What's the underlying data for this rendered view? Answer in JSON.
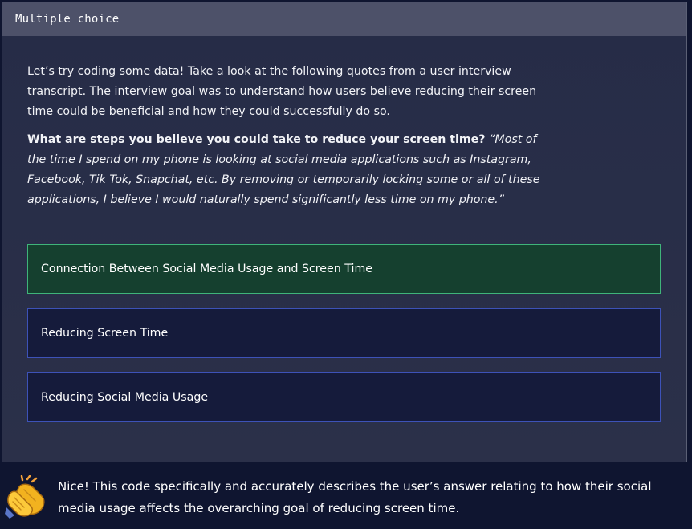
{
  "card": {
    "title": "Multiple choice"
  },
  "prompt": {
    "intro": "Let’s try coding some data! Take a look at the following quotes from a user interview transcript. The interview goal was to understand how users believe reducing their screen time could be beneficial and how they could successfully do so.",
    "question": "What are steps you believe you could take to reduce your screen time?",
    "quote": "“Most of the time I spend on my phone is looking at social media applications such as Instagram, Facebook, Tik Tok, Snapchat, etc. By removing or temporarily locking some or all of these applications, I believe I would naturally spend significantly less time on my phone.”"
  },
  "options": [
    {
      "label": "Connection Between Social Media Usage and Screen Time",
      "selected": true
    },
    {
      "label": "Reducing Screen Time",
      "selected": false
    },
    {
      "label": "Reducing Social Media Usage",
      "selected": false
    }
  ],
  "feedback": {
    "icon": "clapping-hands-icon",
    "text": "Nice! This code specifically and accurately describes the user’s answer relating to how their social media usage affects the overarching goal of reducing screen time."
  },
  "colors": {
    "page_bg": "#0f1530",
    "header_bg": "#4d5169",
    "option_bg": "#151b3b",
    "option_border": "#3d52b8",
    "selected_bg": "#15402f",
    "selected_border": "#3fb47a"
  }
}
